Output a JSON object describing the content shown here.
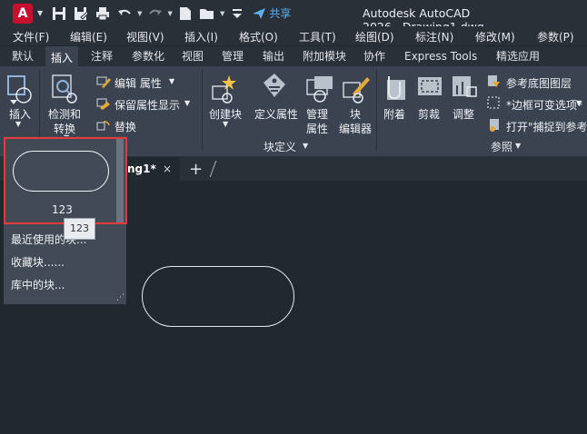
{
  "titlebar": {
    "app_letter": "A",
    "share_label": "共享",
    "app_name": "Autodesk AutoCAD 2026",
    "doc_name": "Drawing1.dwg"
  },
  "menu": [
    "文件(F)",
    "编辑(E)",
    "视图(V)",
    "插入(I)",
    "格式(O)",
    "工具(T)",
    "绘图(D)",
    "标注(N)",
    "修改(M)",
    "参数(P)"
  ],
  "tabs": [
    "默认",
    "插入",
    "注释",
    "参数化",
    "视图",
    "管理",
    "输出",
    "附加模块",
    "协作",
    "Express Tools",
    "精选应用"
  ],
  "active_tab": "插入",
  "ribbon": {
    "insert_label": "插入",
    "detect_label_1": "检测和",
    "detect_label_2": "转换",
    "edit_attr_label": "编辑 属性",
    "keep_attr_label": "保留属性显示",
    "replace_label": "替换",
    "create_block_label": "创建块",
    "define_attr_label": "定义属性",
    "manage_attr_label_1": "管理",
    "manage_attr_label_2": "属性",
    "block_editor_label_1": "块",
    "block_editor_label_2": "编辑器",
    "block_def_panel": "块定义",
    "attach_label": "附着",
    "clip_label": "剪裁",
    "adjust_label": "调整",
    "underlay_layers_label": "参考底图图层",
    "frames_label": "*边框可变选项*",
    "snap_label": "打开\"捕捉到参考",
    "reference_panel": "参照"
  },
  "doc_tab": {
    "label": "ng1*",
    "close": "×",
    "new": "+"
  },
  "gallery": {
    "block_name": "123",
    "tooltip": "123",
    "recent": "最近使用的块...",
    "favorites": "收藏块......",
    "library": "库中的块..."
  },
  "colors": {
    "accent_red": "#e33b3b",
    "autocad_red": "#c8102e",
    "share_blue": "#5ab0f0"
  }
}
